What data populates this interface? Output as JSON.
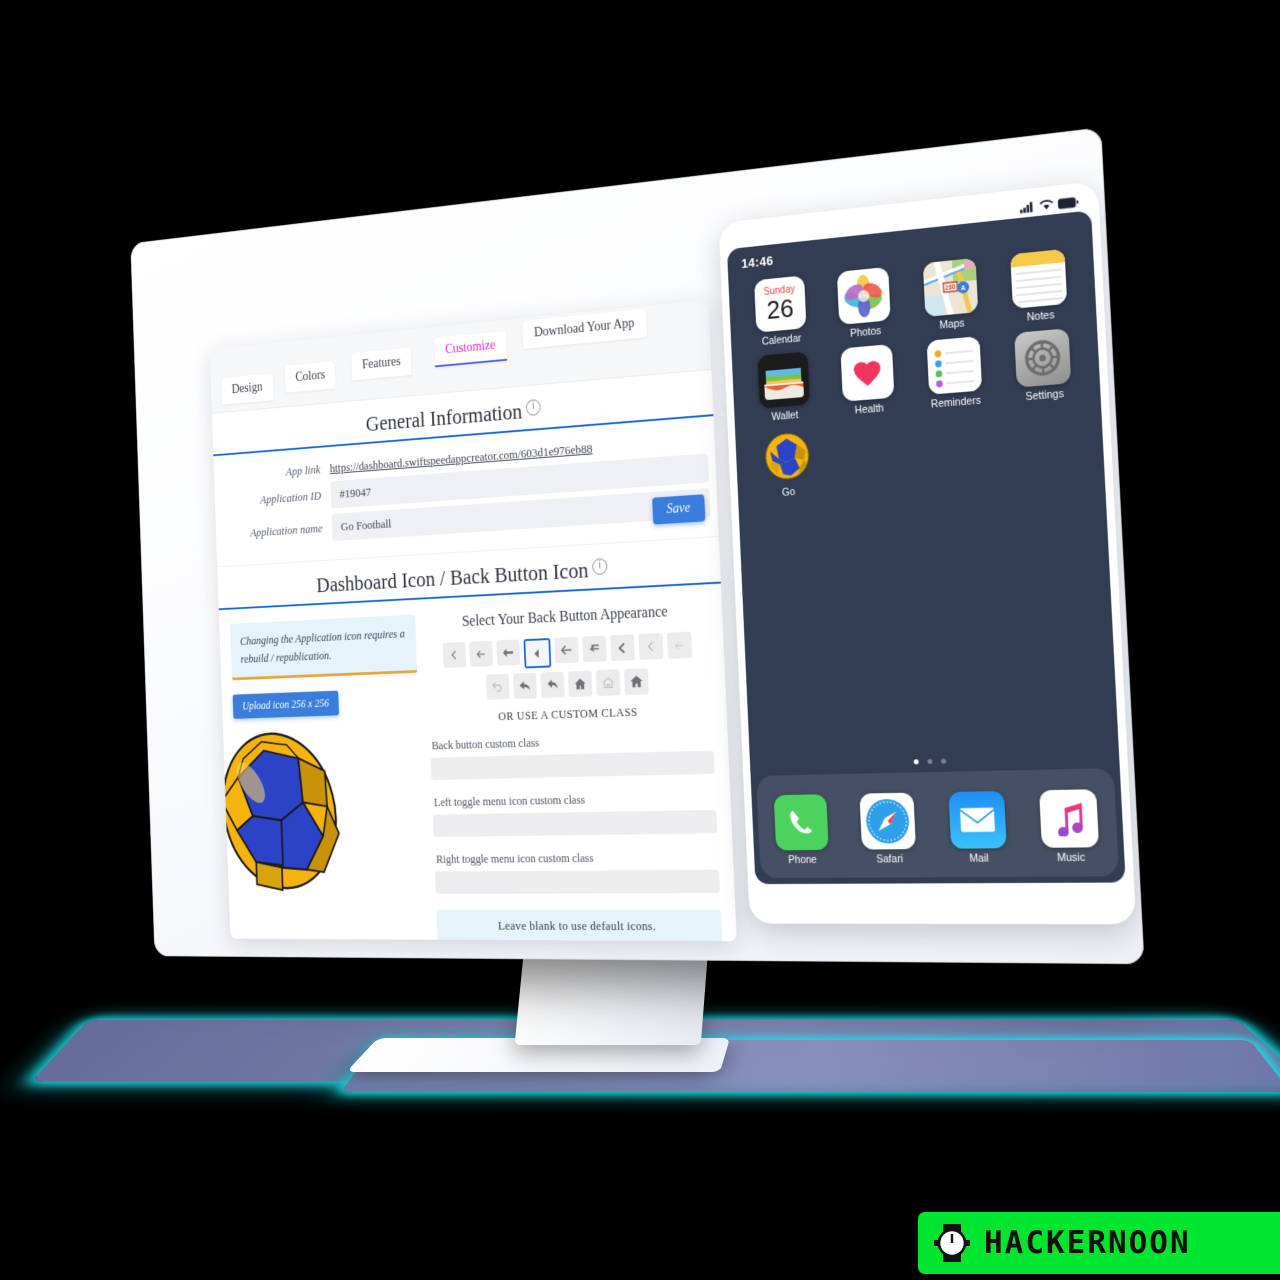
{
  "app": {
    "platform_badge": "HACKERNOON",
    "badge_color": "#00e62e"
  },
  "dashboard": {
    "tabs": [
      {
        "label": "Design",
        "active": false
      },
      {
        "label": "Colors",
        "active": false
      },
      {
        "label": "Features",
        "active": false
      },
      {
        "label": "Customize",
        "active": true
      },
      {
        "label": "Download Your App",
        "active": false
      }
    ],
    "active_tab_color": "#e91ec8",
    "accent_color": "#1565d8",
    "general_information": {
      "title": "General Information",
      "info_icon": "info-icon",
      "rows": [
        {
          "label": "App link",
          "value": "https://dashboard.swiftspeedappcreator.com/603d1e976eb88",
          "type": "link"
        },
        {
          "label": "Application ID",
          "value": "#19047",
          "type": "text"
        },
        {
          "label": "Application name",
          "value": "Go Football",
          "type": "input"
        }
      ],
      "save_label": "Save"
    },
    "dashboard_icon_section": {
      "title": "Dashboard Icon / Back Button Icon",
      "info_icon": "info-icon",
      "alert_text": "Changing the Application icon requires a rebuild / republication.",
      "upload_label": "Upload icon 256 x 256",
      "app_icon_name": "soccer-ball-icon",
      "app_icon_colors": {
        "blue": "#2b44c7",
        "yellow": "#f5b30d",
        "dark_yellow": "#b8860b"
      },
      "back_button_heading": "Select Your Back Button Appearance",
      "back_icons": [
        {
          "name": "chevron-left-thin-icon",
          "selected": false,
          "dim": false
        },
        {
          "name": "arrow-left-thin-icon",
          "selected": false,
          "dim": false
        },
        {
          "name": "arrow-left-bold-icon",
          "selected": false,
          "dim": false
        },
        {
          "name": "caret-left-filled-icon",
          "selected": true,
          "dim": false
        },
        {
          "name": "arrow-left-long-icon",
          "selected": false,
          "dim": false
        },
        {
          "name": "return-arrow-icon",
          "selected": false,
          "dim": false
        },
        {
          "name": "chevron-left-bold-icon",
          "selected": false,
          "dim": false
        },
        {
          "name": "chevron-left-light-icon",
          "selected": false,
          "dim": false
        },
        {
          "name": "arrow-left-faded-icon",
          "selected": false,
          "dim": true
        },
        {
          "name": "undo-curve-faded-icon",
          "selected": false,
          "dim": true
        },
        {
          "name": "reply-arrow-icon",
          "selected": false,
          "dim": false
        },
        {
          "name": "reply-arrow-alt-icon",
          "selected": false,
          "dim": false
        },
        {
          "name": "home-filled-icon",
          "selected": false,
          "dim": false
        },
        {
          "name": "home-outline-icon",
          "selected": false,
          "dim": true
        },
        {
          "name": "home-solid-icon",
          "selected": false,
          "dim": false
        }
      ],
      "or_custom_class": "OR USE A CUSTOM CLASS",
      "custom_fields": [
        {
          "label": "Back button custom class",
          "value": ""
        },
        {
          "label": "Left toggle menu icon custom class",
          "value": ""
        },
        {
          "label": "Right toggle menu icon custom class",
          "value": ""
        }
      ],
      "footer_note": "Leave blank to use default icons."
    }
  },
  "phone": {
    "time": "14:46",
    "status_icons": [
      "signal-icon",
      "wifi-icon",
      "battery-icon"
    ],
    "screen_bg": "#323c52",
    "apps": [
      {
        "label": "Calendar",
        "icon": "calendar-icon",
        "day": "Sunday",
        "date": "26"
      },
      {
        "label": "Photos",
        "icon": "photos-icon"
      },
      {
        "label": "Maps",
        "icon": "maps-icon",
        "badge": "280"
      },
      {
        "label": "Notes",
        "icon": "notes-icon"
      },
      {
        "label": "Wallet",
        "icon": "wallet-icon"
      },
      {
        "label": "Health",
        "icon": "health-icon"
      },
      {
        "label": "Reminders",
        "icon": "reminders-icon"
      },
      {
        "label": "Settings",
        "icon": "settings-icon"
      },
      {
        "label": "Go",
        "icon": "go-soccer-ball-icon"
      }
    ],
    "page_dots": {
      "count": 3,
      "active_index": 0
    },
    "dock": [
      {
        "label": "Phone",
        "icon": "phone-icon"
      },
      {
        "label": "Safari",
        "icon": "safari-icon"
      },
      {
        "label": "Mail",
        "icon": "mail-icon"
      },
      {
        "label": "Music",
        "icon": "music-icon"
      }
    ]
  }
}
